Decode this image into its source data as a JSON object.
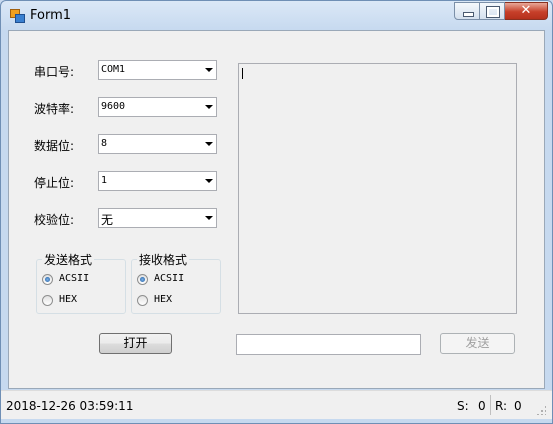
{
  "window": {
    "title": "Form1"
  },
  "settings": [
    {
      "label": "串口号:",
      "value": "COM1"
    },
    {
      "label": "波特率:",
      "value": "9600"
    },
    {
      "label": "数据位:",
      "value": "8"
    },
    {
      "label": "停止位:",
      "value": "1"
    },
    {
      "label": "校验位:",
      "value": "无"
    }
  ],
  "send_format": {
    "title": "发送格式",
    "options": [
      "ACSII",
      "HEX"
    ],
    "selected": "ACSII"
  },
  "receive_format": {
    "title": "接收格式",
    "options": [
      "ACSII",
      "HEX"
    ],
    "selected": "ACSII"
  },
  "receive_area": {
    "text": ""
  },
  "open_button": {
    "label": "打开"
  },
  "send_input": {
    "value": ""
  },
  "send_button": {
    "label": "发送",
    "enabled": false
  },
  "statusbar": {
    "datetime": "2018-12-26 03:59:11",
    "sent_label": "S:",
    "sent_count": "0",
    "recv_label": "R:",
    "recv_count": "0"
  },
  "icons": {
    "app": "app-icon",
    "minimize": "minimize-icon",
    "maximize": "maximize-icon",
    "close": "close-icon"
  }
}
